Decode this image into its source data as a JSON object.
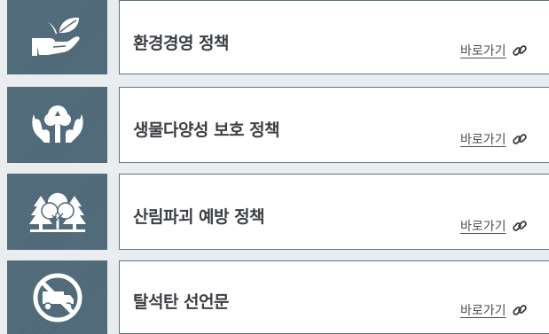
{
  "colors": {
    "icon_bg": "#4e6878",
    "card_border": "#5d7381",
    "background": "#e9edf0",
    "title_text": "#3b3f43"
  },
  "policies": [
    {
      "icon": "hand-leaf-icon",
      "title": "환경경영 정책",
      "link_label": "바로가기",
      "link_icon": "link-icon"
    },
    {
      "icon": "hands-tree-icon",
      "title": "생물다양성 보호 정책",
      "link_label": "바로가기",
      "link_icon": "link-icon"
    },
    {
      "icon": "forest-icon",
      "title": "산림파괴 예방 정책",
      "link_label": "바로가기",
      "link_icon": "link-icon"
    },
    {
      "icon": "no-coal-truck-icon",
      "title": "탈석탄 선언문",
      "link_label": "바로가기",
      "link_icon": "link-icon"
    }
  ]
}
